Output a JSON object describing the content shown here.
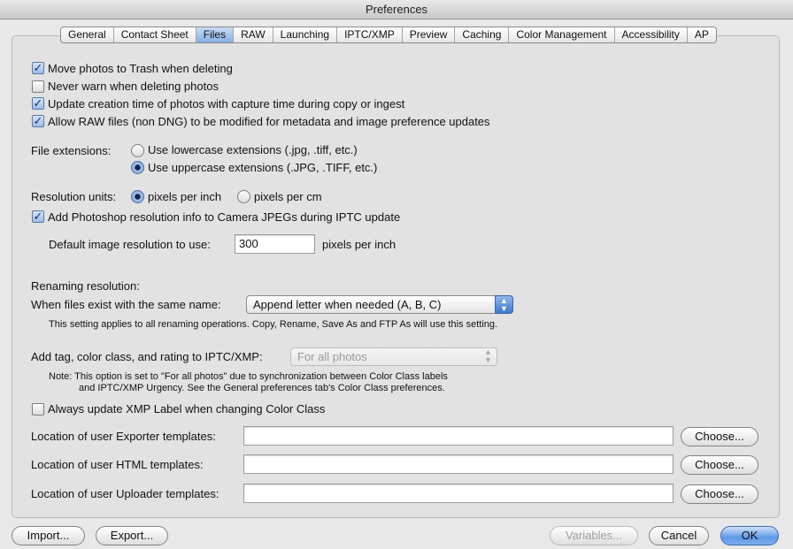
{
  "window": {
    "title": "Preferences"
  },
  "tabs": [
    {
      "label": "General"
    },
    {
      "label": "Contact Sheet"
    },
    {
      "label": "Files",
      "active": true
    },
    {
      "label": "RAW"
    },
    {
      "label": "Launching"
    },
    {
      "label": "IPTC/XMP"
    },
    {
      "label": "Preview"
    },
    {
      "label": "Caching"
    },
    {
      "label": "Color Management"
    },
    {
      "label": "Accessibility"
    },
    {
      "label": "AP"
    }
  ],
  "options": {
    "move_trash": {
      "label": "Move photos to Trash when deleting",
      "checked": true
    },
    "never_warn": {
      "label": "Never warn when deleting photos",
      "checked": false
    },
    "update_creation": {
      "label": "Update creation time of photos with capture time during copy or ingest",
      "checked": true
    },
    "allow_raw": {
      "label": "Allow RAW files (non DNG) to be modified for metadata and image preference updates",
      "checked": true
    }
  },
  "file_extensions": {
    "label": "File extensions:",
    "lowercase": {
      "label": "Use lowercase extensions (.jpg, .tiff, etc.)",
      "selected": false
    },
    "uppercase": {
      "label": "Use uppercase extensions (.JPG, .TIFF, etc.)",
      "selected": true
    }
  },
  "resolution": {
    "label": "Resolution units:",
    "per_inch": {
      "label": "pixels per inch",
      "selected": true
    },
    "per_cm": {
      "label": "pixels per cm",
      "selected": false
    },
    "add_photoshop": {
      "label": "Add Photoshop resolution info to Camera JPEGs during IPTC update",
      "checked": true
    },
    "default_label": "Default image resolution to use:",
    "default_value": "300",
    "default_unit": "pixels per inch"
  },
  "renaming": {
    "heading": "Renaming resolution:",
    "same_name_label": "When files exist with the same name:",
    "same_name_value": "Append letter when needed (A, B, C)",
    "note": "This setting applies to all renaming operations.  Copy, Rename, Save As and FTP As will use this setting."
  },
  "iptc": {
    "label": "Add tag, color class, and rating to IPTC/XMP:",
    "value": "For all photos",
    "note_line1": "Note: This option is set to \"For all photos\" due to synchronization between Color Class labels",
    "note_line2": "and IPTC/XMP Urgency.  See the General preferences tab's Color Class preferences.",
    "always_update": {
      "label": "Always update XMP Label when changing Color Class",
      "checked": false
    }
  },
  "templates": {
    "exporter_label": "Location of user Exporter templates:",
    "exporter_value": "",
    "html_label": "Location of user HTML templates:",
    "html_value": "",
    "uploader_label": "Location of user Uploader templates:",
    "uploader_value": "",
    "choose_label": "Choose..."
  },
  "footer": {
    "import_label": "Import...",
    "export_label": "Export...",
    "variables_label": "Variables...",
    "cancel_label": "Cancel",
    "ok_label": "OK"
  },
  "icons": {
    "check": "checkmark-icon",
    "popup_arrows": "up-down-arrows-icon"
  },
  "colors": {
    "accent": "#5f98e6",
    "background": "#e8e8e8"
  }
}
